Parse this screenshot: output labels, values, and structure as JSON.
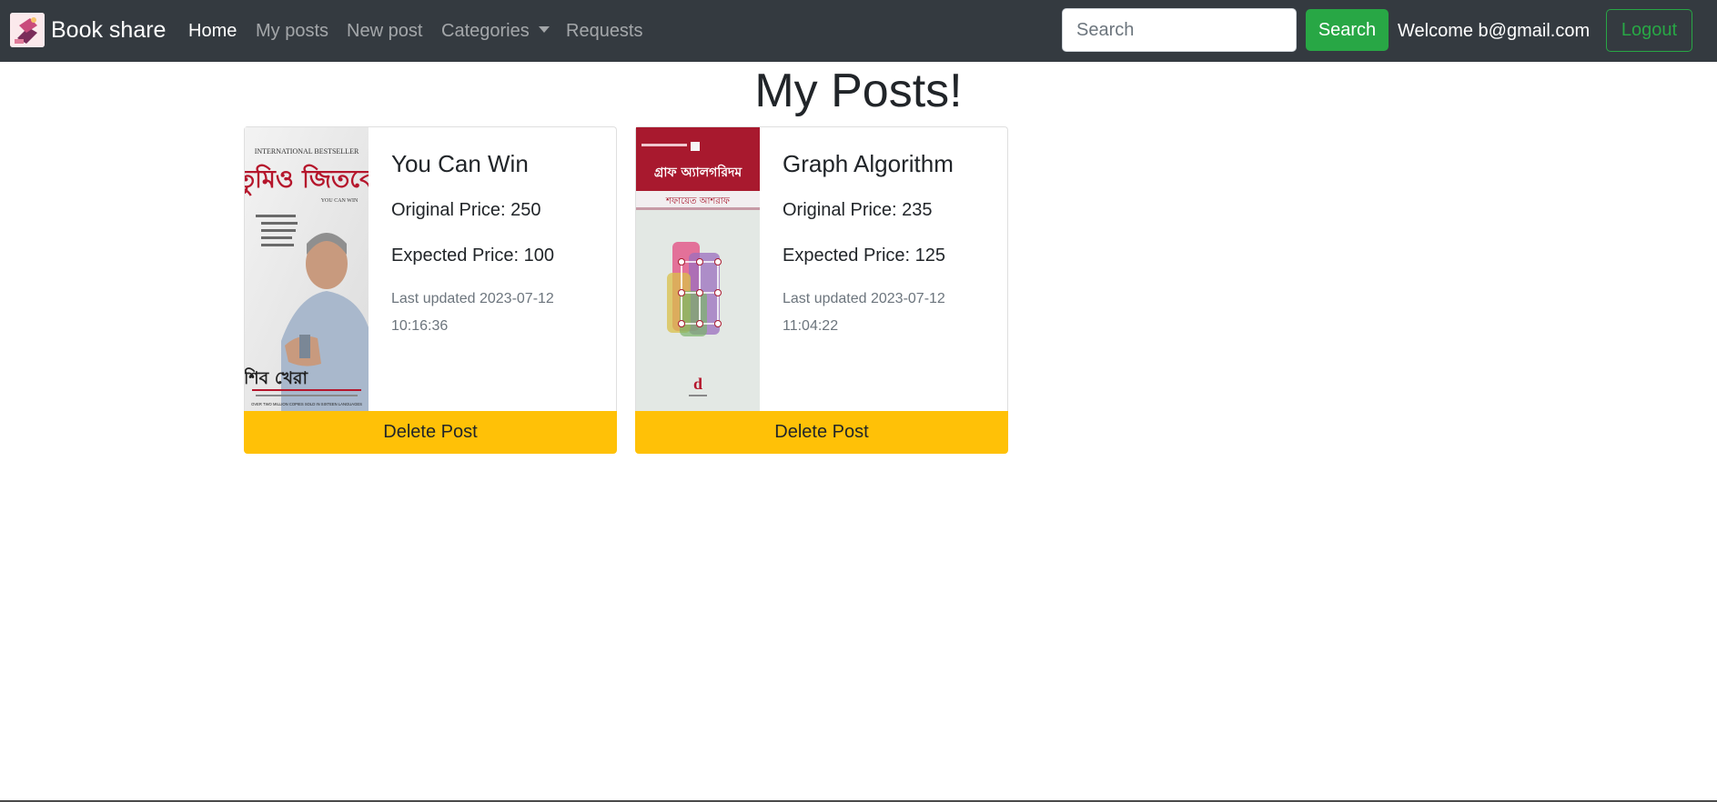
{
  "navbar": {
    "brand": "Book share",
    "links": [
      {
        "label": "Home"
      },
      {
        "label": "My posts"
      },
      {
        "label": "New post"
      },
      {
        "label": "Categories"
      },
      {
        "label": "Requests"
      }
    ],
    "search_placeholder": "Search",
    "search_button": "Search",
    "welcome": "Welcome b@gmail.com",
    "logout_button": "Logout"
  },
  "main": {
    "title": "My Posts!",
    "posts": [
      {
        "title": "You Can Win",
        "original_price": "Original Price: 250",
        "expected_price": "Expected Price: 100",
        "updated_line1": "Last updated 2023-07-12",
        "updated_line2": "10:16:36",
        "delete_label": "Delete Post",
        "cover": {
          "top_text": "INTERNATIONAL BESTSELLER",
          "title_text": "তুমিও জিতবে",
          "subtitle_text": "YOU CAN WIN",
          "author_text": "শিব খেরা",
          "bottom_text": "OVER TWO MILLION COPIES SOLD IN SIXTEEN LANGUAGES"
        }
      },
      {
        "title": "Graph Algorithm",
        "original_price": "Original Price: 235",
        "expected_price": "Expected Price: 125",
        "updated_line1": "Last updated 2023-07-12",
        "updated_line2": "11:04:22",
        "delete_label": "Delete Post",
        "cover": {
          "title_text": "গ্রাফ অ্যালগরিদম",
          "author_text": "শফায়েত আশরাফ"
        }
      }
    ]
  },
  "colors": {
    "navbar_bg": "#343a40",
    "success": "#28a745",
    "warning": "#ffc107",
    "cover_red": "#a8192e"
  }
}
